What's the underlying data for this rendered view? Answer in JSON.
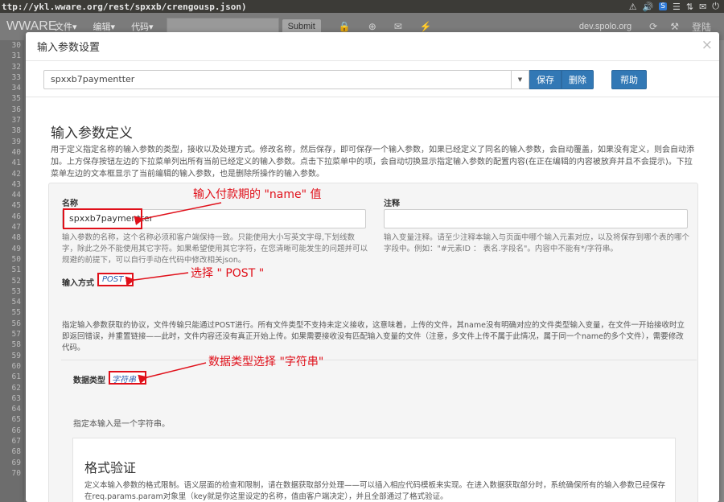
{
  "sysbar": {
    "url": "ttp://ykl.wware.org/rest/spxxb/crengousp.json)",
    "tray": [
      "⚠",
      "🔊",
      "S",
      "☰",
      "⇅",
      "✉",
      "⏻"
    ]
  },
  "appbar": {
    "brand": "WWARE",
    "menus": [
      "文件▾",
      "编辑▾",
      "代码▾"
    ],
    "submit": "Submit",
    "icons": [
      "🔒",
      "⊕",
      "✉",
      "⚡"
    ],
    "host": "dev.spolo.org",
    "icons2": [
      "⟳",
      "⚒",
      "登陆"
    ]
  },
  "gutter": [
    "30",
    "31",
    "32",
    "33",
    "34",
    "35",
    "36",
    "37",
    "38",
    "39",
    "40",
    "41",
    "42",
    "43",
    "44",
    "45",
    "46",
    "47",
    "48",
    "49",
    "50",
    "51",
    "52",
    "53",
    "54",
    "55",
    "56",
    "57",
    "58",
    "59",
    "60",
    "61",
    "62",
    "63",
    "64",
    "65",
    "66",
    "67",
    "68",
    "69",
    "70"
  ],
  "modal": {
    "title": "输入参数设置",
    "close": "×"
  },
  "toolbar": {
    "selected": "spxxb7paymentter",
    "save": "保存",
    "delete": "删除",
    "help": "帮助"
  },
  "section": {
    "title": "输入参数定义",
    "desc": "用于定义指定名称的输入参数的类型，接收以及处理方式。修改名称，然后保存，即可保存一个输入参数，如果已经定义了同名的输入参数，会自动覆盖，如果没有定义，则会自动添加。上方保存按钮左边的下拉菜单列出所有当前已经定义的输入参数。点击下拉菜单中的项，会自动切换显示指定输入参数的配置内容(在正在编辑的内容被放弃并且不会提示)。下拉菜单左边的文本框显示了当前编辑的输入参数，也是删除所操作的输入参数。"
  },
  "form": {
    "name_label": "名称",
    "name_value": "spxxb7paymentter",
    "name_help": "输入参数的名称，这个名称必须和客户端保持一致。只能使用大小写英文字母,下划线数字，除此之外不能使用其它字符。如果希望使用其它字符，在您清晰可能发生的问题并可以规避的前提下，可以自行手动在代码中修改相关json。",
    "note_label": "注释",
    "note_value": "",
    "note_help": "输入变量注释。请至少注释本输入与页面中哪个输入元素对应，以及将保存到哪个表的哪个字段中。例如：\"#元素ID ： 表名.字段名\"。内容中不能有*/字符串。",
    "method_label": "输入方式",
    "method_value": "POST ▾",
    "method_help": "指定输入参数获取的协议，文件传输只能通过POST进行。所有文件类型不支持未定义接收，这意味着，上传的文件，其name没有明确对应的文件类型输入变量，在文件一开始接收时立即返回错误，并重置链接——此时，文件内容还没有真正开始上传。如果需要接收没有匹配输入变量的文件（注意，多文件上传不属于此情况，属于同一个name的多个文件），需要修改代码。",
    "dtype_label": "数据类型",
    "dtype_value": "字符串 ▾",
    "dtype_help": "指定本输入是一个字符串。",
    "fmt_title": "格式验证",
    "fmt_desc": "定义本输入参数的格式限制。语义层面的检查和限制，请在数据获取部分处理——可以插入相应代码模板来实现。在进入数据获取部分时，系统确保所有的输入参数已经保存在req.params.param对象里（key就是你这里设定的名称，值由客户端决定），并且全部通过了格式验证。"
  },
  "annotations": {
    "a1": "输入付款期的 \"name\" 值",
    "a2": "选择 \" POST \"",
    "a3": "数据类型选择 \"字符串\""
  },
  "colors": {
    "primary": "#3278b5",
    "annotation": "#e0101a"
  }
}
